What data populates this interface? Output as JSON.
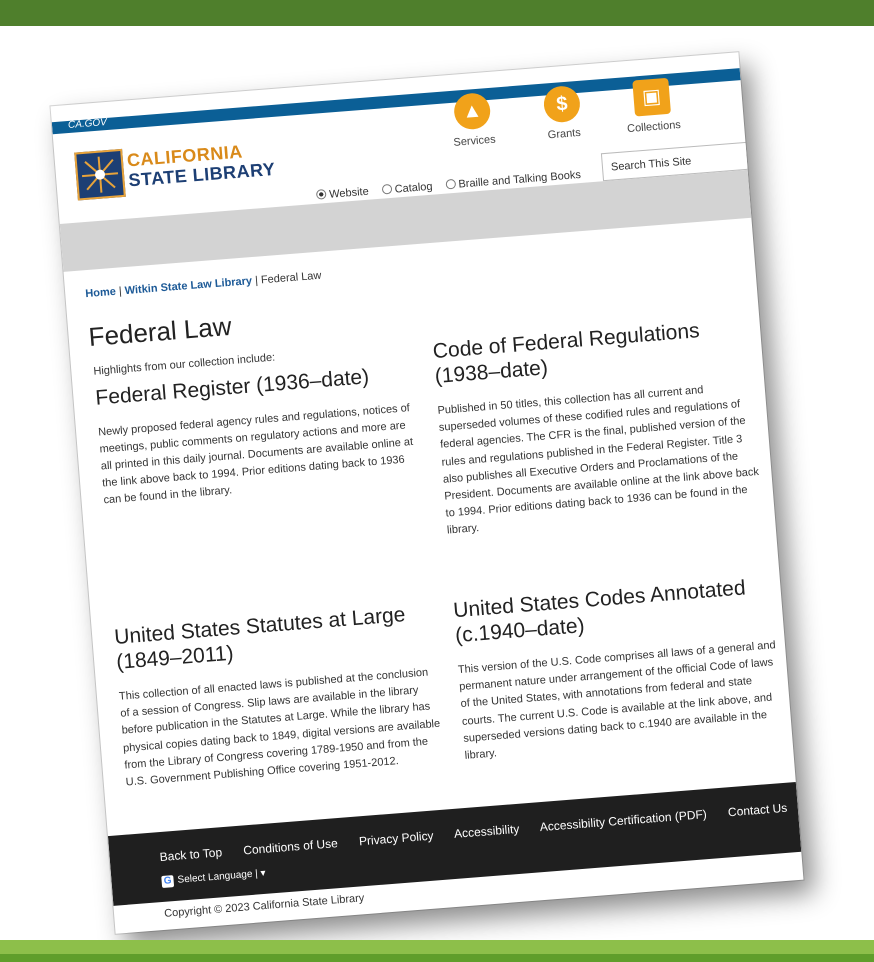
{
  "header": {
    "gov_text": "CA.GOV",
    "logo_line1": "CALIFORNIA",
    "logo_line2": "STATE LIBRARY",
    "quick_links": [
      {
        "label": "Services",
        "icon": "map-icon"
      },
      {
        "label": "Grants",
        "icon": "dollar-icon"
      },
      {
        "label": "Collections",
        "icon": "image-icon"
      }
    ],
    "search_placeholder": "Search This Site",
    "search_options": [
      "Website",
      "Catalog",
      "Braille and Talking Books"
    ],
    "search_selected": "Website"
  },
  "breadcrumb": {
    "home": "Home",
    "sep1": " | ",
    "witkin": "Witkin State Law Library",
    "sep2": " | ",
    "current": "Federal Law"
  },
  "main": {
    "title": "Federal Law",
    "intro": "Highlights from our collection include:",
    "sections": [
      {
        "heading": "Federal Register (1936–date)",
        "body": "Newly proposed federal agency rules and regulations, notices of meetings, public comments on regulatory actions and more are all printed in this daily journal. Documents are available online at the link above back to 1994. Prior editions dating back to 1936 can be found in the library."
      },
      {
        "heading": "Code of Federal Regulations (1938–date)",
        "body": "Published in 50 titles, this collection has all current and superseded volumes of these codified rules and regulations of federal agencies. The CFR is the final, published version of the rules and regulations published in the Federal Register. Title 3 also publishes all Executive Orders and Proclamations of the President. Documents are available online at the link above back to 1994. Prior editions dating back to 1936 can be found in the library."
      },
      {
        "heading": "United States Statutes at Large (1849–2011)",
        "body": "This collection of all enacted laws is published at the conclusion of a session of Congress. Slip laws are available in the library before publication in the Statutes at Large. While the library has physical copies dating back to 1849, digital versions are available from the Library of Congress covering 1789-1950 and from the U.S. Government Publishing Office covering 1951-2012."
      },
      {
        "heading": "United States Codes Annotated (c.1940–date)",
        "body": "This version of the U.S. Code comprises all laws of a general and permanent nature under arrangement of the official Code of laws of the United States, with annotations from federal and state courts. The current U.S. Code is available at the link above, and superseded versions dating back to c.1940 are available in the library."
      }
    ]
  },
  "footer": {
    "links": [
      "Back to Top",
      "Conditions of Use",
      "Privacy Policy",
      "Accessibility",
      "Accessibility Certification (PDF)",
      "Contact Us"
    ],
    "language_label": "Select Language",
    "copyright": "Copyright © 2023 California State Library"
  },
  "colors": {
    "top_band": "#4f7f2c",
    "bottom_band": "#8dbf4a",
    "gov_bar": "#0b5f96",
    "accent_orange": "#f1a21a",
    "link_blue": "#1d5a97",
    "footer_bg": "#1f1f1f"
  }
}
